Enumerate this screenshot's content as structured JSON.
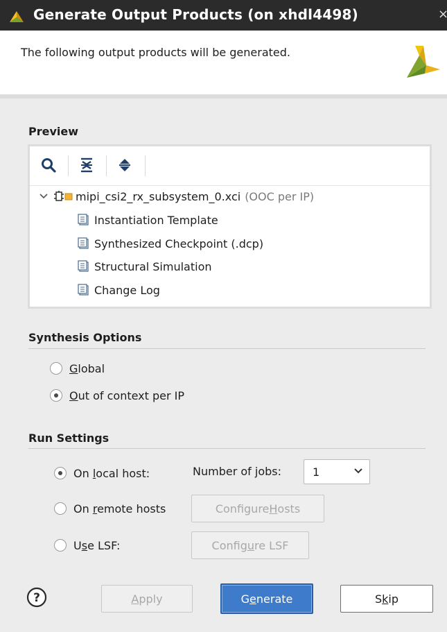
{
  "window": {
    "title": "Generate Output Products (on xhdl4498)",
    "close_glyph": "×"
  },
  "header": {
    "text": "The following output products will be generated."
  },
  "preview": {
    "title": "Preview",
    "toolbar": [
      {
        "name": "search-icon"
      },
      {
        "name": "collapse-all-icon"
      },
      {
        "name": "expand-all-icon"
      }
    ],
    "root": {
      "label": "mipi_csi2_rx_subsystem_0.xci",
      "suffix": "(OOC per IP)"
    },
    "children": [
      "Instantiation Template",
      "Synthesized Checkpoint (.dcp)",
      "Structural Simulation",
      "Change Log"
    ]
  },
  "synthesis_options": {
    "title": "Synthesis Options",
    "global": {
      "label_u": "G",
      "label_rest": "lobal",
      "checked": false
    },
    "ooc": {
      "label_u": "O",
      "label_rest": "ut of context per IP",
      "checked": true
    }
  },
  "run_settings": {
    "title": "Run Settings",
    "local": {
      "pre": "On ",
      "u": "l",
      "post": "ocal host:",
      "checked": true
    },
    "jobs": {
      "pre": "Number of ",
      "u": "j",
      "post": "obs:",
      "value": "1"
    },
    "remote": {
      "pre": "On ",
      "u": "r",
      "post": "emote hosts",
      "checked": false
    },
    "lsf": {
      "pre": "U",
      "u": "s",
      "post": "e LSF:",
      "checked": false
    },
    "configure_hosts": {
      "pre": "Configure ",
      "u": "H",
      "post": "osts"
    },
    "configure_lsf": {
      "pre": "Config",
      "u": "u",
      "post": "re LSF"
    }
  },
  "footer": {
    "help_glyph": "?",
    "apply": {
      "u": "A",
      "post": "pply"
    },
    "generate": {
      "pre": "G",
      "u": "e",
      "post": "nerate"
    },
    "skip": {
      "pre": "S",
      "u": "k",
      "post": "ip"
    }
  },
  "colors": {
    "accent": "#3e7bcb",
    "titlebar": "#2b2b2b",
    "logo": "#e9b21b"
  }
}
